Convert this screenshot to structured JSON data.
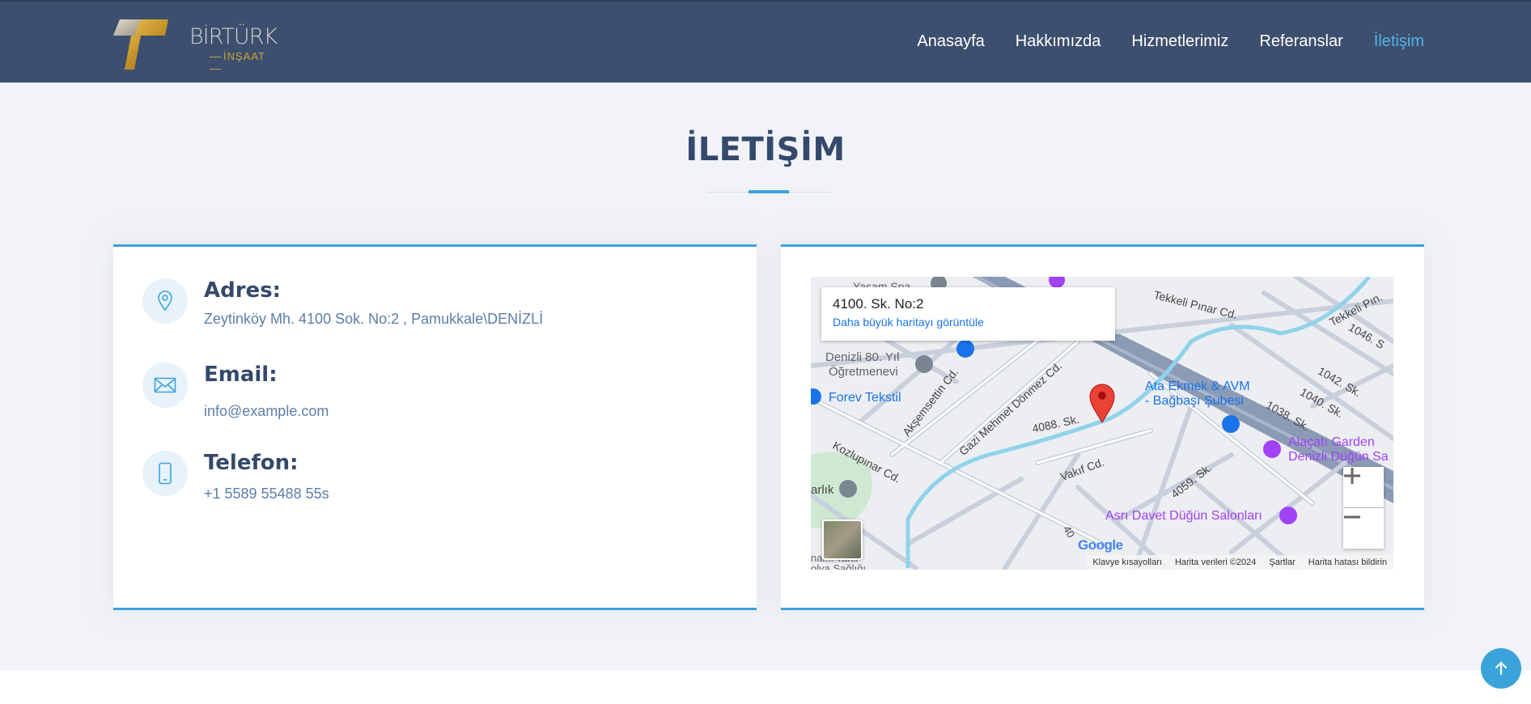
{
  "brand": {
    "name": "BİRTÜRK",
    "sub": "İNŞAAT"
  },
  "nav": [
    {
      "label": "Anasayfa"
    },
    {
      "label": "Hakkımızda"
    },
    {
      "label": "Hizmetlerimiz"
    },
    {
      "label": "Referanslar"
    },
    {
      "label": "İletişim",
      "active": true
    }
  ],
  "section": {
    "title": "İLETİŞİM"
  },
  "contact": {
    "address": {
      "label": "Adres:",
      "value": "Zeytinköy Mh. 4100 Sok. No:2 , Pamukkale\\DENİZLİ",
      "icon": "map-pin-icon"
    },
    "email": {
      "label": "Email:",
      "value": "info@example.com",
      "icon": "envelope-icon"
    },
    "phone": {
      "label": "Telefon:",
      "value": "+1 5589 55488 55s",
      "icon": "phone-icon"
    }
  },
  "map": {
    "place_title": "4100. Sk. No:2",
    "larger_map_link": "Daha büyük haritayı görüntüle",
    "labels": {
      "yasam_spa": "Yaşam Spa",
      "ogretmenevi_1": "Denizli 80. Yıl",
      "ogretmenevi_2": "Öğretmenevi",
      "forev": "Forev Tekstil",
      "akşemsettin": "Akşemsettin Cd.",
      "gazi": "Gazi Mehmet Dönmez Cd.",
      "sk4088": "4088. Sk.",
      "kozlupinar": "Kozlupınar Cd.",
      "vakif": "Vakıf Cd.",
      "sk4059": "4059. Sk.",
      "ata_1": "Ata Ekmek & AVM",
      "ata_2": "- Bağbaşı Şubesi",
      "alacati_1": "Alaçatı Garden",
      "alacati_2": "Denizli Düğün Sa",
      "asri": "Asrı Davet Düğün Salonları",
      "tekkeli": "Tekkeli Pınar Cd.",
      "tekkeli2": "Tekkeli Pın.",
      "sk1046": "1046. S",
      "sk1042": "1042. Sk.",
      "sk1040": "1040. Sk.",
      "sk1038": "1038. Sk.",
      "arlik": "arlık",
      "sk40": "40",
      "bottom_left_1": "nal... Tahir",
      "bottom_left_2": "olya Sağlığı",
      "partial_left": "40"
    },
    "google": "Google",
    "footer": [
      "Klavye kısayolları",
      "Harita verileri ©2024",
      "Şartlar",
      "Harita hatası bildirin"
    ]
  }
}
